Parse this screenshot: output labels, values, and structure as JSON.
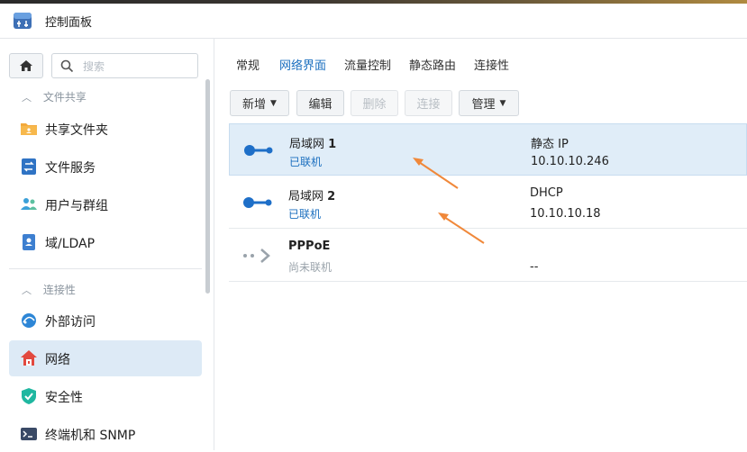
{
  "window": {
    "title": "控制面板"
  },
  "sidebar": {
    "search_placeholder": "搜索",
    "sections": [
      {
        "label": "文件共享",
        "items": [
          {
            "label": "共享文件夹",
            "icon": "shared-folder-icon"
          },
          {
            "label": "文件服务",
            "icon": "file-services-icon"
          },
          {
            "label": "用户与群组",
            "icon": "users-groups-icon"
          },
          {
            "label": "域/LDAP",
            "icon": "domain-ldap-icon"
          }
        ]
      },
      {
        "label": "连接性",
        "items": [
          {
            "label": "外部访问",
            "icon": "external-access-icon"
          },
          {
            "label": "网络",
            "icon": "network-icon",
            "active": true
          },
          {
            "label": "安全性",
            "icon": "security-shield-icon"
          },
          {
            "label": "终端机和 SNMP",
            "icon": "terminal-icon"
          }
        ]
      }
    ]
  },
  "tabs": [
    {
      "label": "常规"
    },
    {
      "label": "网络界面",
      "active": true
    },
    {
      "label": "流量控制"
    },
    {
      "label": "静态路由"
    },
    {
      "label": "连接性"
    }
  ],
  "toolbar": {
    "add": "新增",
    "edit": "编辑",
    "delete": "删除",
    "connect": "连接",
    "manage": "管理"
  },
  "interfaces": [
    {
      "name": "局域网",
      "num": "1",
      "status": "已联机",
      "type": "静态 IP",
      "ip": "10.10.10.246",
      "selected": true
    },
    {
      "name": "局域网",
      "num": "2",
      "status": "已联机",
      "type": "DHCP",
      "ip": "10.10.10.18"
    },
    {
      "name": "PPPoE",
      "num": "",
      "status": "尚未联机",
      "type": "",
      "ip": "--"
    }
  ],
  "colors": {
    "accent": "#1b6fbf",
    "selected_row": "#e0edf8",
    "annotation_arrow": "#f0883a"
  }
}
